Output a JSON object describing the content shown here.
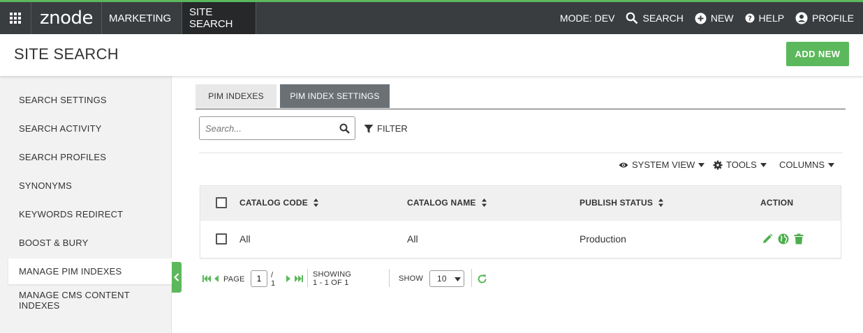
{
  "topbar": {
    "logo": "znode",
    "marketing_label": "MARKETING",
    "site_search_label": "SITE SEARCH",
    "mode_label": "MODE: DEV",
    "search_label": "SEARCH",
    "new_label": "NEW",
    "help_label": "HELP",
    "profile_label": "PROFILE"
  },
  "header": {
    "title": "SITE SEARCH",
    "add_new_label": "ADD NEW"
  },
  "sidebar": {
    "items": [
      {
        "label": "SEARCH SETTINGS"
      },
      {
        "label": "SEARCH ACTIVITY"
      },
      {
        "label": "SEARCH PROFILES"
      },
      {
        "label": "SYNONYMS"
      },
      {
        "label": "KEYWORDS REDIRECT"
      },
      {
        "label": "BOOST & BURY"
      },
      {
        "label": "MANAGE PIM INDEXES",
        "active": true
      },
      {
        "label": "MANAGE CMS CONTENT INDEXES"
      }
    ]
  },
  "tabs": [
    {
      "label": "PIM INDEXES"
    },
    {
      "label": "PIM INDEX SETTINGS",
      "active": true
    }
  ],
  "search": {
    "placeholder": "Search...",
    "filter_label": "FILTER"
  },
  "toolbar": {
    "system_view_label": "SYSTEM VIEW",
    "tools_label": "TOOLS",
    "columns_label": "COLUMNS"
  },
  "grid": {
    "columns": [
      "CATALOG CODE",
      "CATALOG NAME",
      "PUBLISH STATUS",
      "ACTION"
    ],
    "rows": [
      {
        "catalog_code": "All",
        "catalog_name": "All",
        "publish_status": "Production"
      }
    ]
  },
  "pager": {
    "page_label": "PAGE",
    "current_page": "1",
    "total_pages": "/ 1",
    "showing_label": "SHOWING 1 - 1 OF 1",
    "show_label": "SHOW",
    "page_size": "10"
  },
  "colors": {
    "accent": "#5cb85c",
    "topbar": "#3a3d40",
    "active_tab": "#6b7075"
  },
  "icons": [
    "apps-grid-icon",
    "chevron-down-icon",
    "search-icon",
    "plus-circle-icon",
    "help-icon",
    "profile-icon",
    "filter-icon",
    "eye-icon",
    "gear-icon",
    "sort-icon",
    "edit-icon",
    "globe-icon",
    "delete-icon",
    "first-page-icon",
    "prev-page-icon",
    "next-page-icon",
    "last-page-icon",
    "refresh-icon",
    "collapse-left-icon"
  ]
}
